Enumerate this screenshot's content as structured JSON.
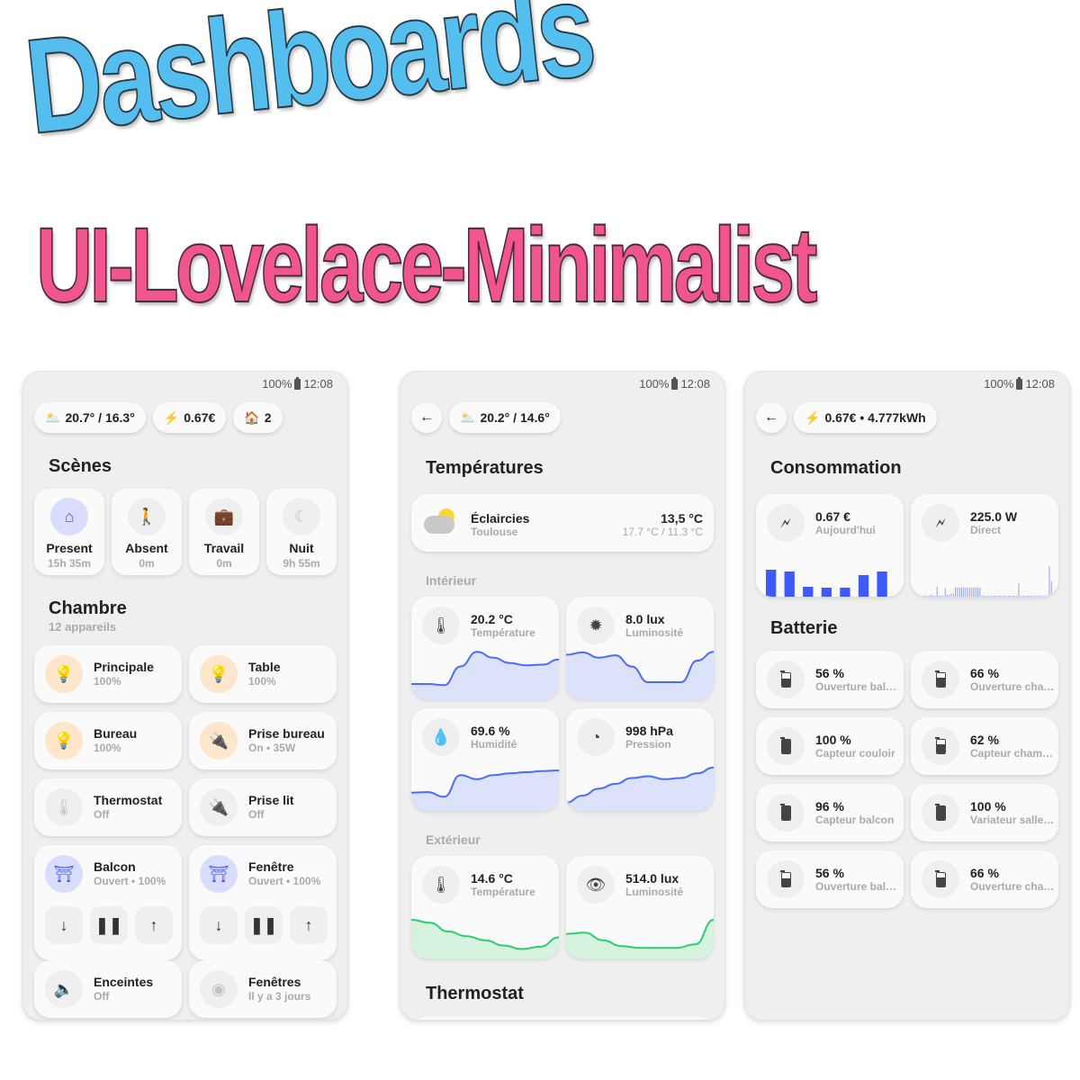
{
  "titles": {
    "line1": "Dashboards",
    "line2": "UI-Lovelace-Minimalist"
  },
  "colors": {
    "title1": "#54bfef",
    "title2": "#f0558f",
    "accent_blue": "#3d5afe",
    "accent_orange": "#f98c00",
    "accent_green": "#2ecc71"
  },
  "phones": [
    {
      "status": {
        "battery": "100%",
        "time": "12:08"
      },
      "chips": [
        {
          "icon": "weather-icon",
          "glyph": "🌥️",
          "label": "20.7° / 16.3°"
        },
        {
          "icon": "lightning-icon",
          "glyph": "⚡",
          "label": "0.67€"
        },
        {
          "icon": "house-icon",
          "glyph": "🏠",
          "label": "2"
        }
      ],
      "scenes_title": "Scènes",
      "scenes": [
        {
          "name": "Present",
          "duration": "15h 35m",
          "icon": "home-icon",
          "glyph": "⌂",
          "active": true
        },
        {
          "name": "Absent",
          "duration": "0m",
          "icon": "walk-icon",
          "glyph": "🚶",
          "active": false
        },
        {
          "name": "Travail",
          "duration": "0m",
          "icon": "briefcase-icon",
          "glyph": "💼",
          "active": false
        },
        {
          "name": "Nuit",
          "duration": "9h 55m",
          "icon": "moon-icon",
          "glyph": "☾",
          "active": false
        }
      ],
      "room_title": "Chambre",
      "room_subtitle": "12 appareils",
      "devices": [
        {
          "name": "Principale",
          "state": "100%",
          "icon": "bulb-icon",
          "glyph": "💡",
          "style": "orange"
        },
        {
          "name": "Table",
          "state": "100%",
          "icon": "bulb-icon",
          "glyph": "💡",
          "style": "orange"
        },
        {
          "name": "Bureau",
          "state": "100%",
          "icon": "bulb-icon",
          "glyph": "💡",
          "style": "orange"
        },
        {
          "name": "Prise bureau",
          "state": "On • 35W",
          "icon": "plug-icon",
          "glyph": "🔌",
          "style": "orange"
        },
        {
          "name": "Thermostat",
          "state": "Off",
          "icon": "thermometer-icon",
          "glyph": "🌡",
          "style": "grey"
        },
        {
          "name": "Prise lit",
          "state": "Off",
          "icon": "plug-icon",
          "glyph": "🔌",
          "style": "grey"
        }
      ],
      "covers": [
        {
          "name": "Balcon",
          "state": "Ouvert • 100%",
          "icon": "gate-icon",
          "glyph": "⛩"
        },
        {
          "name": "Fenêtre",
          "state": "Ouvert • 100%",
          "icon": "gate-icon",
          "glyph": "⛩"
        }
      ],
      "cover_buttons": {
        "down": "↓",
        "pause": "❚❚",
        "up": "↑"
      },
      "bottom_devices": [
        {
          "name": "Enceintes",
          "state": "Off",
          "icon": "speaker-icon",
          "glyph": "🔈",
          "style": "grey"
        },
        {
          "name": "Fenêtres",
          "state": "Il y a 3 jours",
          "icon": "radio-icon",
          "glyph": "◉",
          "style": "grey"
        }
      ]
    },
    {
      "status": {
        "battery": "100%",
        "time": "12:08"
      },
      "back_glyph": "←",
      "chip": {
        "glyph": "🌥️",
        "label": "20.2° / 14.6°"
      },
      "title": "Températures",
      "weather": {
        "condition": "Éclaircies",
        "location": "Toulouse",
        "temp": "13,5 °C",
        "range": "17.7 °C / 11.3 °C"
      },
      "interior_label": "Intérieur",
      "interior": [
        {
          "value": "20.2 °C",
          "label": "Température",
          "icon": "thermometer-icon",
          "glyph": "🌡",
          "series": [
            2,
            2,
            1.8,
            5,
            7.5,
            6.5,
            5.6,
            5.2,
            5.3,
            6.2
          ]
        },
        {
          "value": "8.0 lux",
          "label": "Luminosité",
          "icon": "brightness-icon",
          "glyph": "✹",
          "series": [
            7,
            7.4,
            6.5,
            6.9,
            5,
            2.3,
            2.3,
            2.3,
            6,
            7.5
          ]
        },
        {
          "value": "69.6 %",
          "label": "Humidité",
          "icon": "water-percent-icon",
          "glyph": "💧",
          "series": [
            2.5,
            2.6,
            1.8,
            5.5,
            4.8,
            5.5,
            5.8,
            6,
            6.2,
            6.3
          ]
        },
        {
          "value": "998 hPa",
          "label": "Pression",
          "icon": "gauge-icon",
          "glyph": "◔",
          "series": [
            0.8,
            2,
            3.2,
            4,
            5,
            5.3,
            4.8,
            5,
            5.8,
            6.8
          ]
        }
      ],
      "exterior_label": "Extérieur",
      "exterior": [
        {
          "value": "14.6 °C",
          "label": "Température",
          "icon": "thermometer-icon",
          "glyph": "🌡",
          "series": [
            6,
            5.5,
            4,
            3.2,
            2.5,
            1.6,
            1,
            1.4,
            3
          ]
        },
        {
          "value": "514.0 lux",
          "label": "Luminosité",
          "icon": "eye-icon",
          "glyph": "👁",
          "series": [
            3.6,
            3.8,
            2.5,
            1.5,
            1.2,
            1.2,
            1.2,
            1.8,
            6
          ]
        }
      ],
      "thermostat_title": "Thermostat"
    },
    {
      "status": {
        "battery": "100%",
        "time": "12:08"
      },
      "back_glyph": "←",
      "chip": {
        "glyph": "⚡",
        "label": "0.67€ • 4.777kWh"
      },
      "title": "Consommation",
      "energy": [
        {
          "value": "0.67 €",
          "label": "Aujourd'hui",
          "icon": "flash-icon",
          "glyph": "🗲",
          "bars": [
            30,
            28,
            11,
            10,
            10,
            24,
            28
          ]
        },
        {
          "value": "225.0 W",
          "label": "Direct",
          "icon": "flash-icon",
          "glyph": "🗲",
          "bars": [
            1,
            1,
            1,
            1,
            1,
            1,
            1,
            2,
            1,
            1,
            10,
            1,
            1,
            1,
            8,
            2,
            2,
            3,
            3,
            9,
            9,
            9,
            9,
            9,
            9,
            9,
            9,
            9,
            9,
            9,
            9,
            9,
            1,
            1,
            1,
            1,
            1,
            1,
            1,
            1,
            1,
            1,
            1,
            1,
            1,
            1,
            1,
            1,
            1,
            1,
            13,
            1,
            1,
            1,
            1,
            1,
            1,
            1,
            1,
            1,
            1,
            1,
            1,
            1,
            1,
            30,
            15
          ]
        }
      ],
      "battery_title": "Batterie",
      "batteries": [
        {
          "value": "56 %",
          "label": "Ouverture balcon",
          "level": 56
        },
        {
          "value": "66 %",
          "label": "Ouverture chambre",
          "level": 66
        },
        {
          "value": "100 %",
          "label": "Capteur couloir",
          "level": 100
        },
        {
          "value": "62 %",
          "label": "Capteur chambre",
          "level": 62
        },
        {
          "value": "96 %",
          "label": "Capteur balcon",
          "level": 96
        },
        {
          "value": "100 %",
          "label": "Variateur salle de bain",
          "level": 100
        },
        {
          "value": "56 %",
          "label": "Ouverture balcon",
          "level": 56
        },
        {
          "value": "66 %",
          "label": "Ouverture chambre",
          "level": 66
        }
      ]
    }
  ]
}
